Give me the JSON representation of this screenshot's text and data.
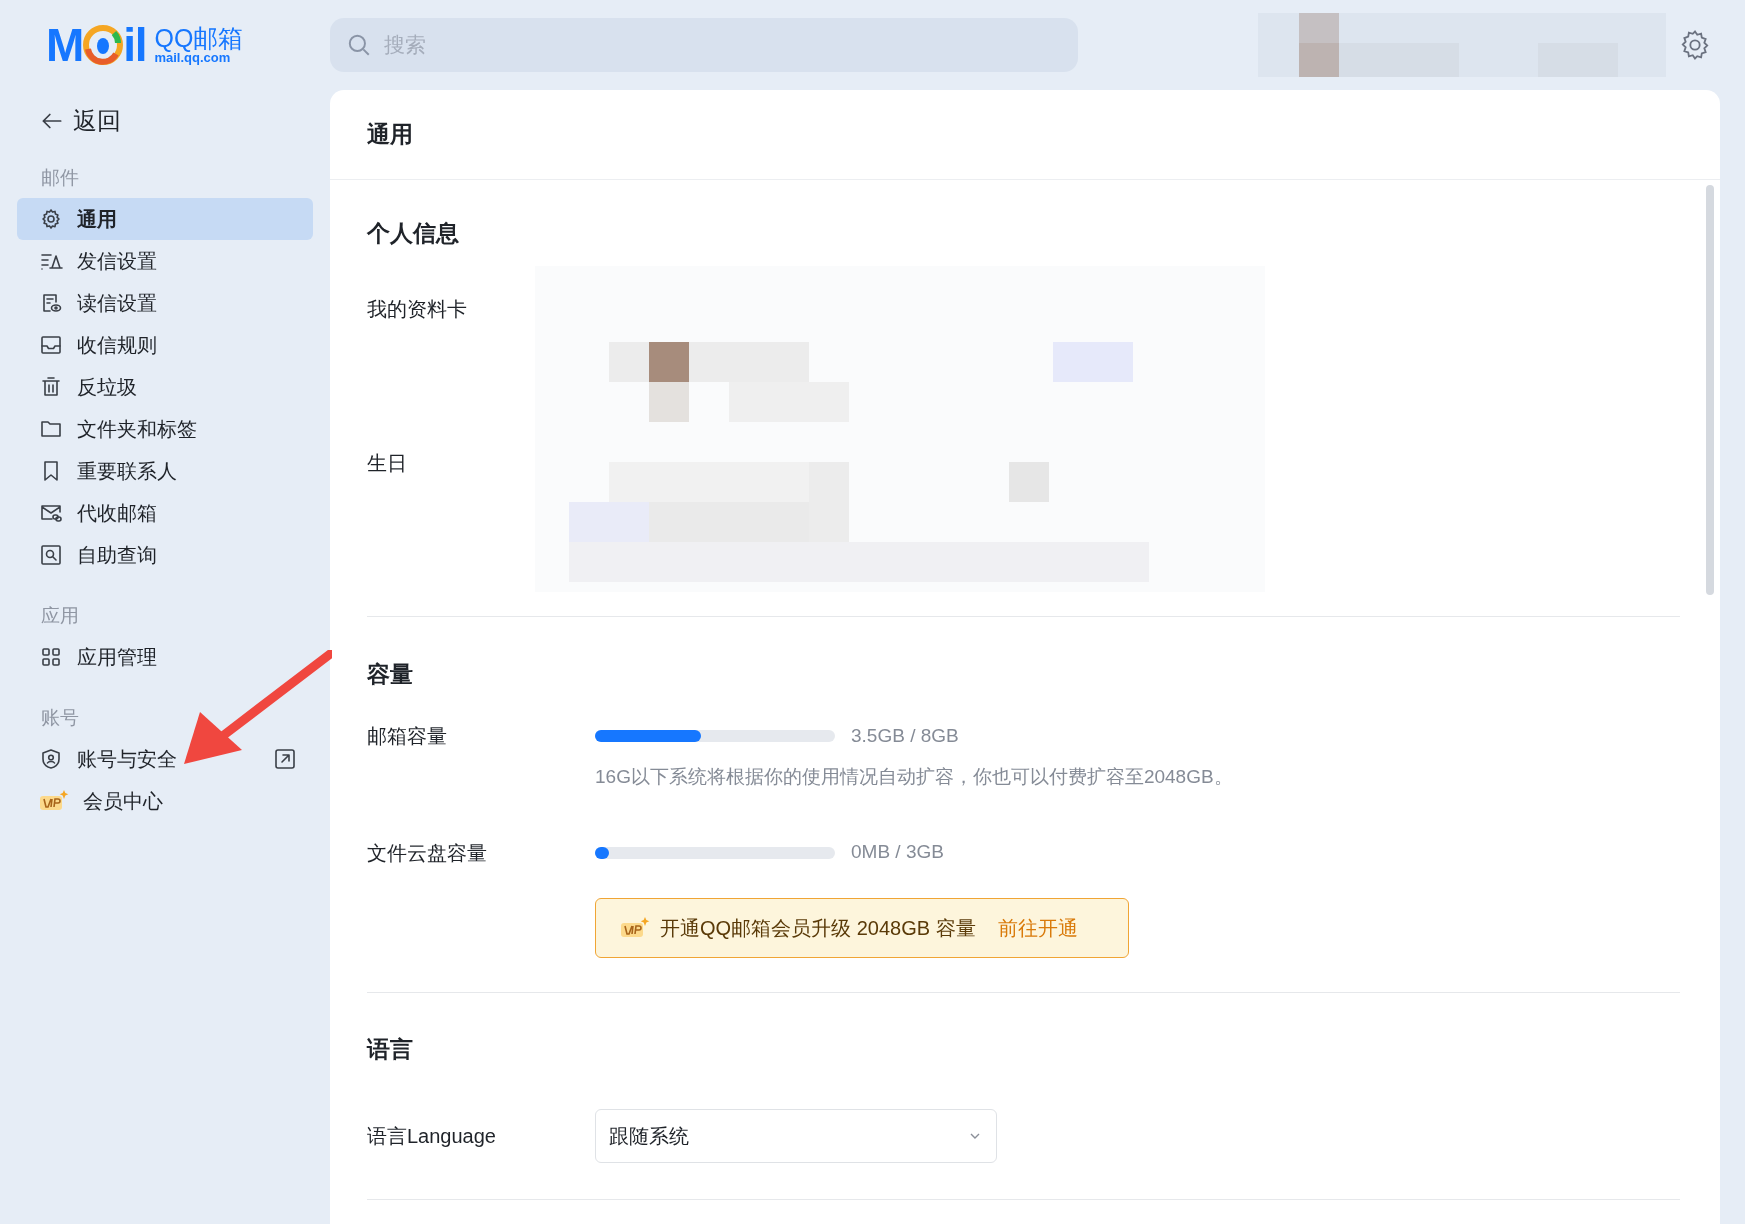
{
  "logo": {
    "letters_before": "M",
    "letters_after": "il",
    "product": "QQ邮箱",
    "domain": "mail.qq.com"
  },
  "search": {
    "placeholder": "搜索"
  },
  "sidebar": {
    "back": "返回",
    "sections": [
      {
        "title": "邮件",
        "items": [
          {
            "label": "通用",
            "kind": "gear",
            "selected": true
          },
          {
            "label": "发信设置",
            "kind": "compose",
            "selected": false
          },
          {
            "label": "读信设置",
            "kind": "read",
            "selected": false
          },
          {
            "label": "收信规则",
            "kind": "inbox",
            "selected": false
          },
          {
            "label": "反垃圾",
            "kind": "trash",
            "selected": false
          },
          {
            "label": "文件夹和标签",
            "kind": "folder",
            "selected": false
          },
          {
            "label": "重要联系人",
            "kind": "bookmark",
            "selected": false
          },
          {
            "label": "代收邮箱",
            "kind": "mail",
            "selected": false
          },
          {
            "label": "自助查询",
            "kind": "lookup",
            "selected": false
          }
        ]
      },
      {
        "title": "应用",
        "items": [
          {
            "label": "应用管理",
            "kind": "grid",
            "selected": false
          }
        ]
      },
      {
        "title": "账号",
        "items": [
          {
            "label": "账号与安全",
            "kind": "shield",
            "selected": false,
            "external": true
          },
          {
            "label": "会员中心",
            "kind": "vip",
            "selected": false
          }
        ]
      }
    ]
  },
  "page": {
    "title": "通用",
    "sections": [
      {
        "kind": "profile",
        "title": "个人信息",
        "rows": [
          {
            "label": "我的资料卡"
          },
          {
            "label": "生日"
          }
        ]
      },
      {
        "kind": "capacity",
        "title": "容量",
        "rows": [
          {
            "label": "邮箱容量",
            "level": 0.44,
            "reading": "3.5GB / 8GB",
            "note": "16G以下系统将根据你的使用情况自动扩容，你也可以付费扩容至2048GB。"
          },
          {
            "label": "文件云盘容量",
            "level": 0.06,
            "reading": "0MB / 3GB"
          }
        ],
        "banner": {
          "text": "开通QQ邮箱会员升级 2048GB 容量",
          "link": "前往开通"
        }
      },
      {
        "kind": "language",
        "title": "语言",
        "rows": [
          {
            "label": "语言Language",
            "value": "跟随系统"
          }
        ]
      }
    ]
  }
}
